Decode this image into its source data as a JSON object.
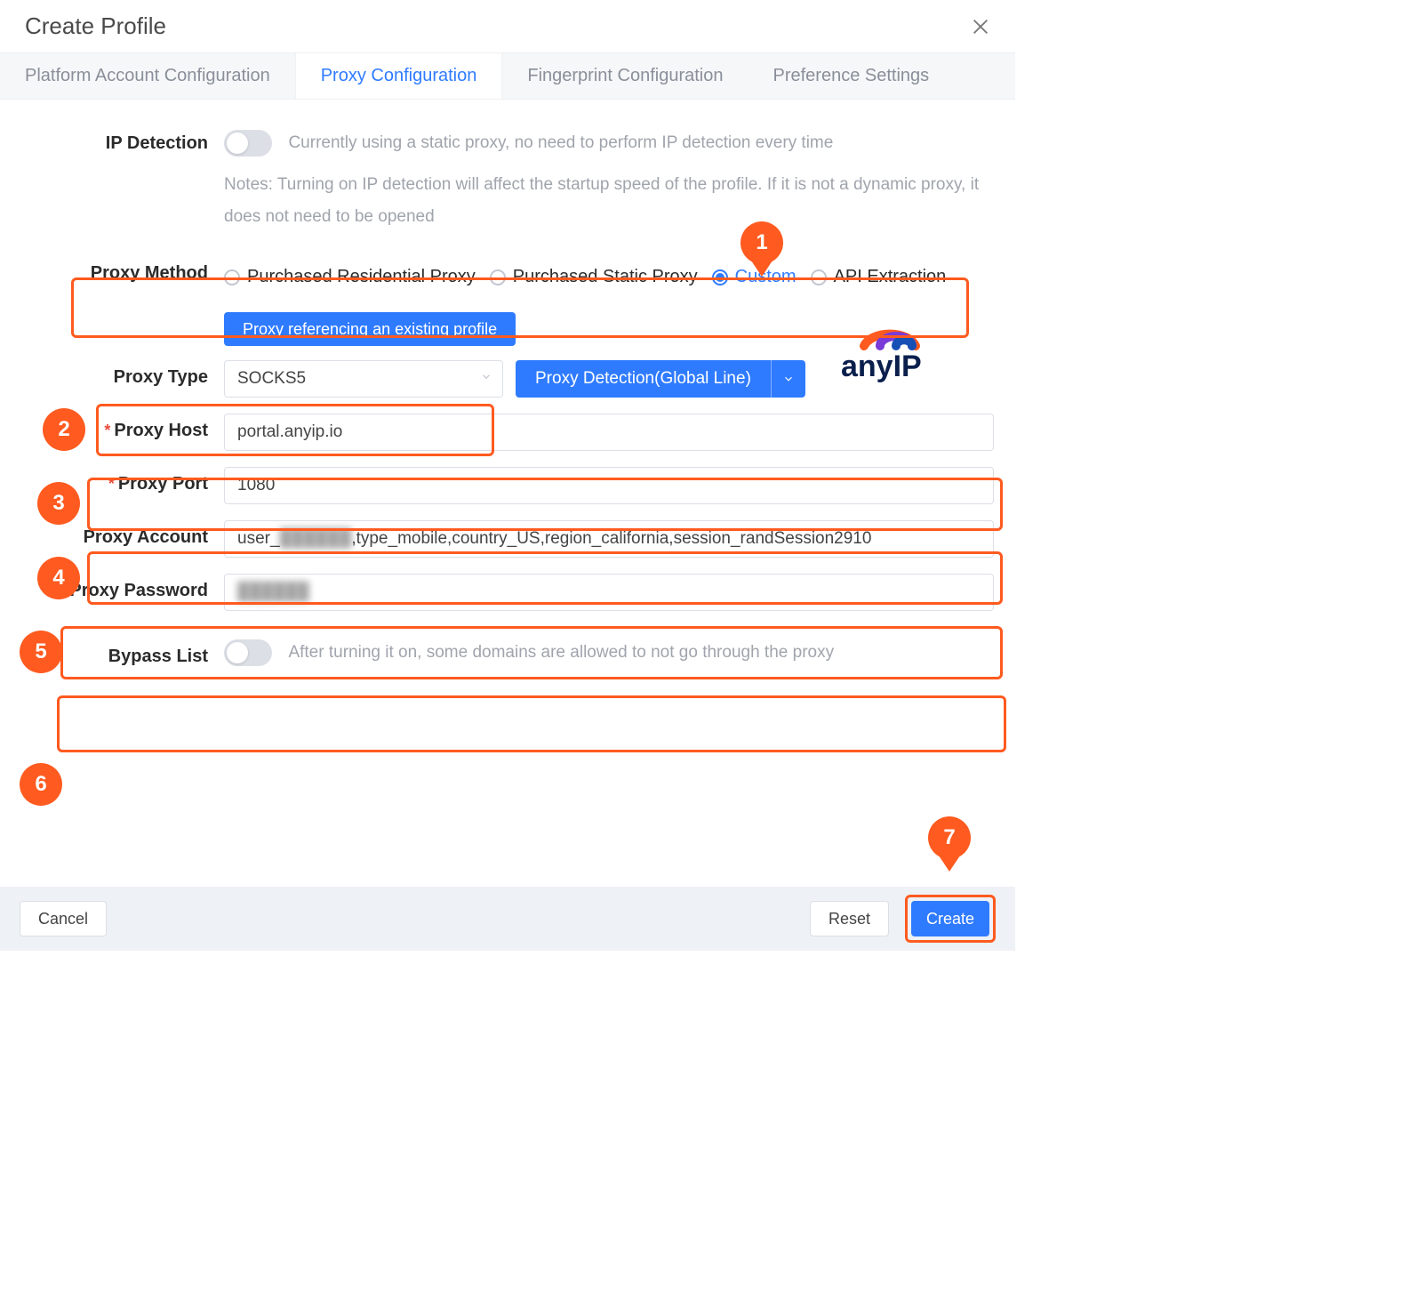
{
  "dialog": {
    "title": "Create Profile"
  },
  "tabs": {
    "items": [
      {
        "label": "Platform Account Configuration",
        "active": false
      },
      {
        "label": "Proxy Configuration",
        "active": true
      },
      {
        "label": "Fingerprint Configuration",
        "active": false
      },
      {
        "label": "Preference Settings",
        "active": false
      }
    ]
  },
  "ip_detection": {
    "label": "IP Detection",
    "status_text": "Currently using a static proxy, no need to perform IP detection every time",
    "enabled": false,
    "notes": "Notes: Turning on IP detection will affect the startup speed of the profile. If it is not a dynamic proxy, it does not need to be opened"
  },
  "proxy_method": {
    "label": "Proxy Method",
    "options": [
      {
        "label": "Purchased Residential Proxy",
        "selected": false
      },
      {
        "label": "Purchased Static Proxy",
        "selected": false
      },
      {
        "label": "Custom",
        "selected": true
      },
      {
        "label": "API Extraction",
        "selected": false
      }
    ]
  },
  "proxy_ref_button": "Proxy referencing an existing profile",
  "proxy_type": {
    "label": "Proxy Type",
    "value": "SOCKS5",
    "detect_button": "Proxy Detection(Global Line)"
  },
  "proxy_host": {
    "label": "Proxy Host",
    "required": true,
    "value": "portal.anyip.io"
  },
  "proxy_port": {
    "label": "Proxy Port",
    "required": true,
    "value": "1080"
  },
  "proxy_account": {
    "label": "Proxy Account",
    "value_prefix": "user_",
    "value_hidden": "██████",
    "value_suffix": ",type_mobile,country_US,region_california,session_randSession2910"
  },
  "proxy_password": {
    "label": "Proxy Password",
    "value_hidden": "██████"
  },
  "bypass_list": {
    "label": "Bypass List",
    "enabled": false,
    "desc": "After turning it on, some domains are allowed to not go through the proxy"
  },
  "footer": {
    "cancel": "Cancel",
    "reset": "Reset",
    "create": "Create"
  },
  "markers": {
    "m1": "1",
    "m2": "2",
    "m3": "3",
    "m4": "4",
    "m5": "5",
    "m6": "6",
    "m7": "7"
  },
  "brand_text_any": "any",
  "brand_text_ip": "IP",
  "colors": {
    "accent": "#2f7bff",
    "highlight": "#ff5a1f"
  }
}
